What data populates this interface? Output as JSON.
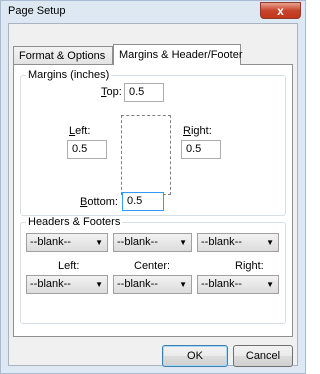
{
  "window": {
    "title": "Page Setup",
    "close_label": "x"
  },
  "tabs": [
    {
      "label": "Format & Options",
      "active": false
    },
    {
      "label": "Margins & Header/Footer",
      "active": true
    }
  ],
  "margins": {
    "group_label": "Margins (inches)",
    "top": {
      "accel": "T",
      "rest": "op:",
      "value": "0.5"
    },
    "left": {
      "accel": "L",
      "rest": "eft:",
      "value": "0.5"
    },
    "right": {
      "accel": "R",
      "rest": "ight:",
      "value": "0.5"
    },
    "bottom": {
      "accel": "B",
      "rest": "ottom:",
      "value": "0.5"
    }
  },
  "headers_footers": {
    "group_label": "Headers & Footers",
    "header_left": "--blank--",
    "header_center": "--blank--",
    "header_right": "--blank--",
    "left_label": "Left:",
    "center_label": "Center:",
    "right_label": "Right:",
    "footer_left": "--blank--",
    "footer_center": "--blank--",
    "footer_right": "--blank--"
  },
  "buttons": {
    "ok": "OK",
    "cancel": "Cancel"
  }
}
